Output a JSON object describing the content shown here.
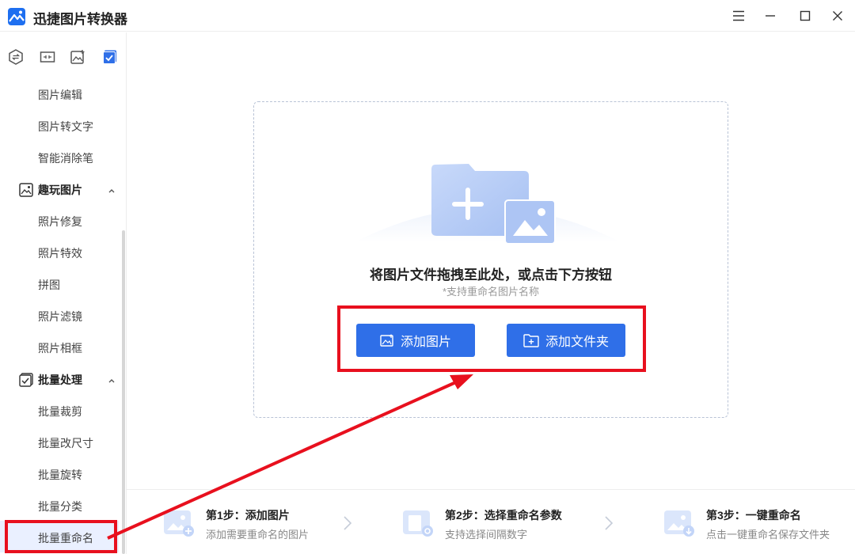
{
  "app": {
    "title": "迅捷图片转换器"
  },
  "sidebar": {
    "items_top": [
      "图片编辑",
      "图片转文字",
      "智能消除笔"
    ],
    "group_fun": {
      "label": "趣玩图片",
      "items": [
        "照片修复",
        "照片特效",
        "拼图",
        "照片滤镜",
        "照片相框"
      ]
    },
    "group_batch": {
      "label": "批量处理",
      "items": [
        "批量裁剪",
        "批量改尺寸",
        "批量旋转",
        "批量分类",
        "批量重命名"
      ]
    },
    "active_item": "批量重命名"
  },
  "dropzone": {
    "title": "将图片文件拖拽至此处，或点击下方按钮",
    "subtitle": "*支持重命名图片名称",
    "add_image_label": "添加图片",
    "add_folder_label": "添加文件夹"
  },
  "steps": [
    {
      "title": "第1步：添加图片",
      "desc": "添加需要重命名的图片"
    },
    {
      "title": "第2步：选择重命名参数",
      "desc": "支持选择间隔数字"
    },
    {
      "title": "第3步：一键重命名",
      "desc": "点击一键重命名保存文件夹"
    }
  ],
  "colors": {
    "accent": "#2f6fe8",
    "annotation": "#e8101e",
    "active_bg": "#eaf0ff"
  }
}
